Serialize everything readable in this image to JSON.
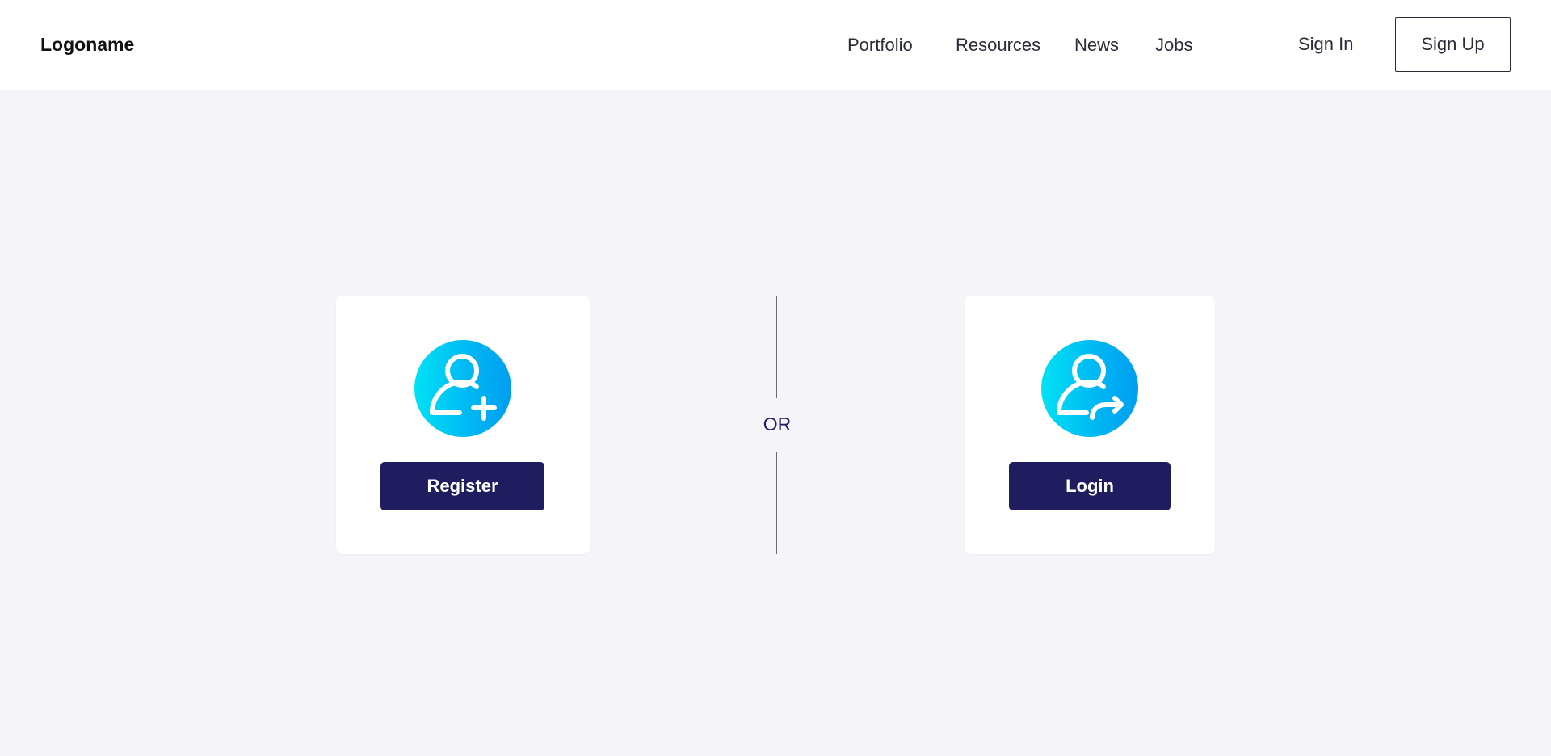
{
  "header": {
    "logo": "Logoname",
    "nav": [
      "Portfolio",
      "Resources",
      "News",
      "Jobs"
    ],
    "sign_in": "Sign In",
    "sign_up": "Sign Up"
  },
  "main": {
    "register": {
      "icon": "user-add-icon",
      "button": "Register"
    },
    "divider": "OR",
    "login": {
      "icon": "user-login-icon",
      "button": "Login"
    }
  },
  "colors": {
    "page_background": "#f4f4f9",
    "button_primary": "#1f1d5f",
    "icon_gradient_start": "#00e2f5",
    "icon_gradient_end": "#009ef0"
  }
}
